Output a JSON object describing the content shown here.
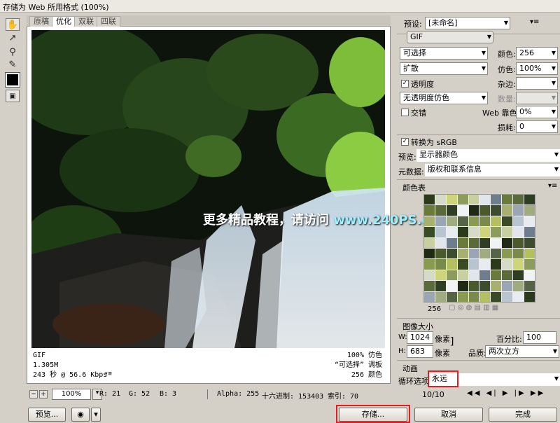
{
  "window": {
    "title": "存储为 Web 所用格式 (100%)"
  },
  "tools": [
    "hand-icon",
    "slice-select-icon",
    "zoom-icon",
    "eyedropper-icon"
  ],
  "tabs": [
    "原稿",
    "优化",
    "双联",
    "四联"
  ],
  "watermark": {
    "text_cn": "更多精品教程，请访问",
    "text_url": "www.240PS.com"
  },
  "info": {
    "format": "GIF",
    "size": "1.305M",
    "speed": "243 秒 @ 56.6 Kbps",
    "dither": "100% 仿色",
    "palette": "“可选择” 调板",
    "colors": "256 颜色"
  },
  "statusbar": {
    "zoom": "100%",
    "r": "R: 21",
    "g": "G: 52",
    "b": "B: 3",
    "alpha": "Alpha: 255",
    "hex": "十六进制: 153403",
    "index": "索引: 70"
  },
  "buttons": {
    "preview": "预览...",
    "save": "存储...",
    "cancel": "取消",
    "done": "完成"
  },
  "settings": {
    "preset_label": "预设:",
    "preset_value": "[未命名]",
    "format_value": "GIF",
    "reduction": "可选择",
    "dither_algo": "扩散",
    "transparency_label": "透明度",
    "transparency_checked": "✓",
    "transparency_dither": "无透明度仿色",
    "interlace_label": "交错",
    "colors_label": "颜色:",
    "colors_value": "256",
    "dither_label": "仿色:",
    "dither_value": "100%",
    "matte_label": "杂边:",
    "amount_label": "数量:",
    "web_snap_label": "Web 靠色:",
    "web_snap_value": "0%",
    "lossy_label": "损耗:",
    "lossy_value": "0",
    "convert_label": "转换为 sRGB",
    "convert_checked": "✓",
    "preview_label": "预览:",
    "preview_value": "显示器颜色",
    "metadata_label": "元数据:",
    "metadata_value": "版权和联系信息"
  },
  "color_table": {
    "title": "颜色表",
    "count": "256"
  },
  "image_size": {
    "title": "图像大小",
    "w_label": "W:",
    "w_value": "1024",
    "h_label": "H:",
    "h_value": "683",
    "unit": "像素",
    "percent_label": "百分比:",
    "percent_value": "100",
    "quality_label": "品质:",
    "quality_value": "两次立方"
  },
  "animation": {
    "title": "动画",
    "loop_label": "循环选项:",
    "loop_value": "永远",
    "frame": "10/10"
  },
  "accent_red": "#e02020"
}
